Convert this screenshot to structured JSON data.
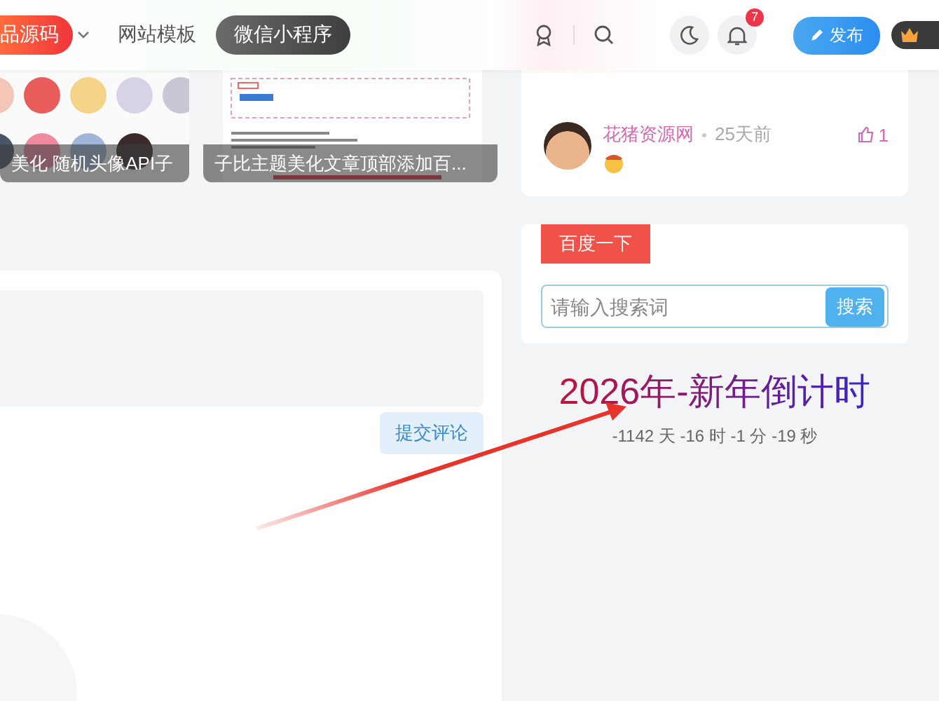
{
  "header": {
    "nav": [
      {
        "label": "品源码",
        "kind": "pill-red",
        "dropdown": true
      },
      {
        "label": "网站模板",
        "kind": "plain",
        "dropdown": false
      },
      {
        "label": "微信小程序",
        "kind": "pill-dark",
        "dropdown": false
      }
    ],
    "notification_count": "7",
    "publish_button": "发布"
  },
  "posts": [
    {
      "caption": "美化 随机头像API子",
      "kind": "avatars"
    },
    {
      "caption": "子比主题美化文章顶部添加百...",
      "kind": "document"
    }
  ],
  "comment_form": {
    "submit_button": "提交评论"
  },
  "comments": [
    {
      "author": "花猪资源网",
      "time": "25天前",
      "likes": "1"
    }
  ],
  "search_widget": {
    "tab": "百度一下",
    "placeholder": "请输入搜索词",
    "button": "搜索"
  },
  "countdown": {
    "title": "2026年-新年倒计时",
    "remaining": "-1142 天 -16 时 -1 分 -19 秒"
  }
}
